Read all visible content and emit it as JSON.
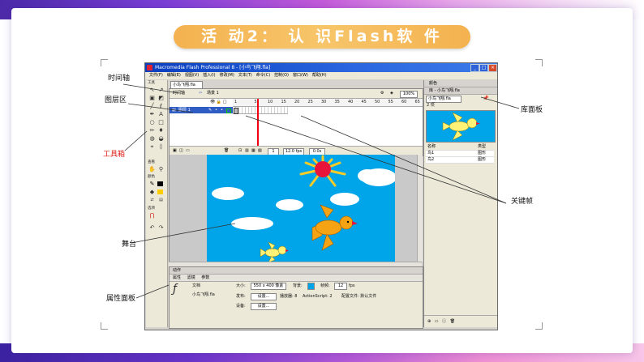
{
  "slide": {
    "title": "活  动2： 认 识Flash软  件",
    "colors": {
      "banner": "#f4b24f",
      "stage": "#00a4e8",
      "titlebar": "#0a3fbf",
      "annotation_red": "#e0201a"
    }
  },
  "annotations": {
    "timeline": "时间轴",
    "layers": "图层区",
    "toolbox": "工具箱",
    "stage": "舞台",
    "properties": "属性面板",
    "library": "库面板",
    "keyframe": "关键帧"
  },
  "app": {
    "title": "Macromedia Flash Professional 8 - [小鸟飞翔.fla]",
    "window_buttons": [
      "_",
      "□",
      "×"
    ],
    "menu": [
      "文件(F)",
      "编辑(E)",
      "视图(V)",
      "插入(I)",
      "修改(M)",
      "文本(T)",
      "命令(C)",
      "控制(O)",
      "窗口(W)",
      "帮助(H)"
    ],
    "doc_tab": "小鸟飞翔.fla",
    "toolbox": {
      "heading_tools": "工具",
      "heading_view": "查看",
      "heading_colors": "颜色",
      "heading_options": "选项",
      "icons": [
        "arrow-icon",
        "subselect-icon",
        "line-icon",
        "lasso-icon",
        "pen-icon",
        "text-icon",
        "oval-icon",
        "rect-icon",
        "pencil-icon",
        "brush-icon",
        "freetransform-icon",
        "fill-transform-icon",
        "inkbottle-icon",
        "paintbucket-icon",
        "eyedropper-icon",
        "eraser-icon"
      ]
    },
    "timeline": {
      "tab": "时间轴",
      "scene": "场景 1",
      "zoom": "100%",
      "ruler": [
        "1",
        "5",
        "10",
        "15",
        "20",
        "25",
        "30",
        "35",
        "40",
        "45",
        "50",
        "55",
        "60",
        "65"
      ],
      "layer_name": "图层 1",
      "frame": "1",
      "fps": "12.0 fps",
      "time": "0.0s"
    },
    "properties": {
      "panel_title": "动作",
      "tabs": [
        "属性",
        "滤镜",
        "参数"
      ],
      "doc_label": "文档",
      "doc_name": "小鸟飞翔.fla",
      "size_label": "大小:",
      "size_value": "550 x 400 像素",
      "bg_label": "背景:",
      "fps_label": "帧频:",
      "fps_value": "12",
      "fps_unit": "fps",
      "publish_label": "发布:",
      "settings_button": "设置...",
      "player_info": "播放器: 8",
      "as_info": "ActionScript: 2",
      "profile_info": "配置文件: 默认文件",
      "device_label": "设备:",
      "device_button": "设置..."
    },
    "right_panels": {
      "color_panel": "颜色",
      "library_panel": "库 - 小鸟飞翔.fla",
      "library_dropdown": "小鸟飞翔.fla",
      "item_count": "2 项",
      "col_name": "名称",
      "col_type": "类型",
      "items": [
        {
          "name": "鸟1",
          "type": "图形"
        },
        {
          "name": "鸟2",
          "type": "图形"
        }
      ]
    }
  }
}
